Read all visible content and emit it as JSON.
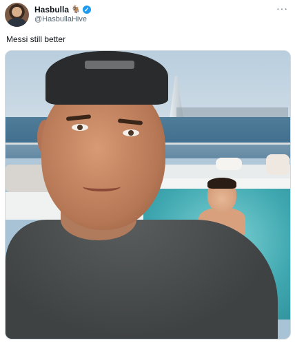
{
  "tweet": {
    "display_name": "Hasbulla",
    "name_emoji": "🐐",
    "verified_glyph": "✓",
    "handle": "@HasbullaHive",
    "more_glyph": "···",
    "text": "Messi still better"
  },
  "colors": {
    "verified_badge": "#1d9bf0",
    "secondary_text": "#536471"
  }
}
